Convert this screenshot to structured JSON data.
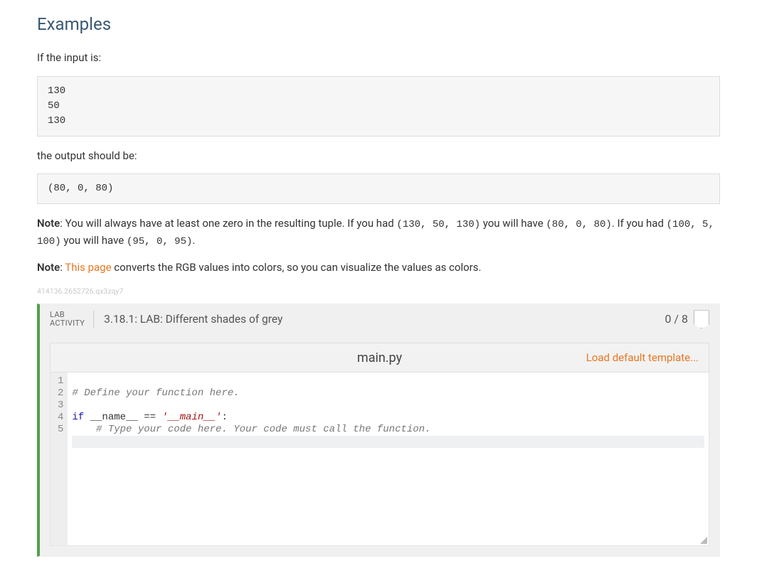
{
  "headings": {
    "examples": "Examples"
  },
  "text": {
    "if_input": "If the input is:",
    "output_should_be": "the output should be:",
    "note1_prefix": "Note",
    "note1_body_a": ": You will always have at least one zero in the resulting tuple. If you had ",
    "note1_code1": "(130, 50, 130)",
    "note1_body_b": " you will have ",
    "note1_code2": "(80, 0, 80)",
    "note1_body_c": ". If you had ",
    "note1_code3": "(100, 5, 100)",
    "note1_body_d": " you will have ",
    "note1_code4": "(95, 0, 95)",
    "note1_body_e": ".",
    "note2_prefix": "Note",
    "note2_link": "This page",
    "note2_body": " converts the RGB values into colors, so you can visualize the values as colors.",
    "watermark": "414136.2652726.qx3zqy7"
  },
  "code_blocks": {
    "input_example": "130\n50\n130",
    "output_example": "(80, 0, 80)"
  },
  "lab": {
    "label_line1": "LAB",
    "label_line2": "ACTIVITY",
    "title": "3.18.1: LAB: Different shades of grey",
    "score": "0 / 8",
    "filename": "main.py",
    "load_template": "Load default template...",
    "code": {
      "line1_comment": "# Define your function here.",
      "line3_if": "if",
      "line3_name": " __name__ ",
      "line3_eq": "==",
      "line3_str": " '__main__'",
      "line3_colon": ":",
      "line4_comment": "    # Type your code here. Your code must call the function."
    },
    "line_numbers": [
      "1",
      "2",
      "3",
      "4",
      "5"
    ]
  }
}
